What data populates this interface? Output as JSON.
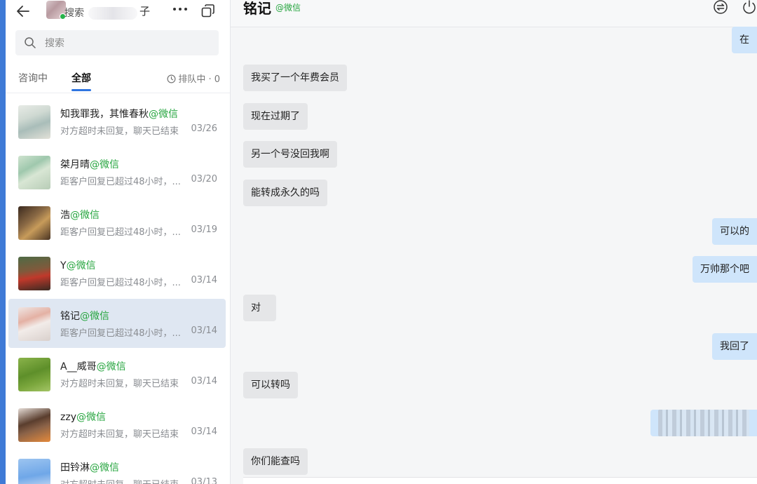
{
  "top_bar": {
    "search_label": "搜索",
    "account_name_suffix": "子"
  },
  "search": {
    "placeholder": "搜索"
  },
  "tabs": [
    {
      "label": "咨询中",
      "active": false
    },
    {
      "label": "全部",
      "active": true
    }
  ],
  "queue": {
    "label": "排队中 · 0"
  },
  "contacts": [
    {
      "name": "知我罪我，其惟春秋",
      "source": "@微信",
      "preview": "对方超时未回复，聊天已结束",
      "date": "03/26",
      "selected": false
    },
    {
      "name": "桀月晴",
      "source": "@微信",
      "preview": "距客户回复已超过48小时，...",
      "date": "03/20",
      "selected": false
    },
    {
      "name": "浩",
      "source": "@微信",
      "preview": "距客户回复已超过48小时，...",
      "date": "03/19",
      "selected": false
    },
    {
      "name": "Y",
      "source": "@微信",
      "preview": "距客户回复已超过48小时，...",
      "date": "03/14",
      "selected": false
    },
    {
      "name": "铭记",
      "source": "@微信",
      "preview": "距客户回复已超过48小时，...",
      "date": "03/14",
      "selected": true
    },
    {
      "name": "A__威哥",
      "source": "@微信",
      "preview": "对方超时未回复，聊天已结束",
      "date": "03/14",
      "selected": false
    },
    {
      "name": "zzy",
      "source": "@微信",
      "preview": "对方超时未回复，聊天已结束",
      "date": "03/14",
      "selected": false
    },
    {
      "name": "田铃淋",
      "source": "@微信",
      "preview": "对方超时未回复，聊天已结束",
      "date": "03/13",
      "selected": false
    }
  ],
  "chat": {
    "title": "铭记",
    "source": "@微信",
    "messages": [
      {
        "dir": "out",
        "text": "在"
      },
      {
        "dir": "in",
        "text": "我买了一个年费会员"
      },
      {
        "dir": "in",
        "text": "现在过期了"
      },
      {
        "dir": "in",
        "text": "另一个号没回我啊"
      },
      {
        "dir": "in",
        "text": "能转成永久的吗"
      },
      {
        "dir": "out",
        "text": "可以的"
      },
      {
        "dir": "out",
        "text": "万帅那个吧"
      },
      {
        "dir": "in",
        "text": "对"
      },
      {
        "dir": "out",
        "text": "我回了"
      },
      {
        "dir": "in",
        "text": "可以转吗"
      },
      {
        "dir": "out",
        "text": "",
        "blurred": true
      },
      {
        "dir": "in",
        "text": "你们能查吗"
      }
    ]
  },
  "colors": {
    "accent": "#2f75e0",
    "wechat_green": "#26a53f",
    "selected_row": "#dfe7f2",
    "outgoing_bubble": "#cfe5fb",
    "incoming_bubble": "#e5e6e8"
  },
  "icons": {
    "back": "arrow-left-icon",
    "more": "more-horizontal-icon",
    "copy": "copy-window-icon",
    "search": "search-icon",
    "queue": "clock-icon",
    "transfer": "transfer-icon",
    "end": "power-icon"
  }
}
